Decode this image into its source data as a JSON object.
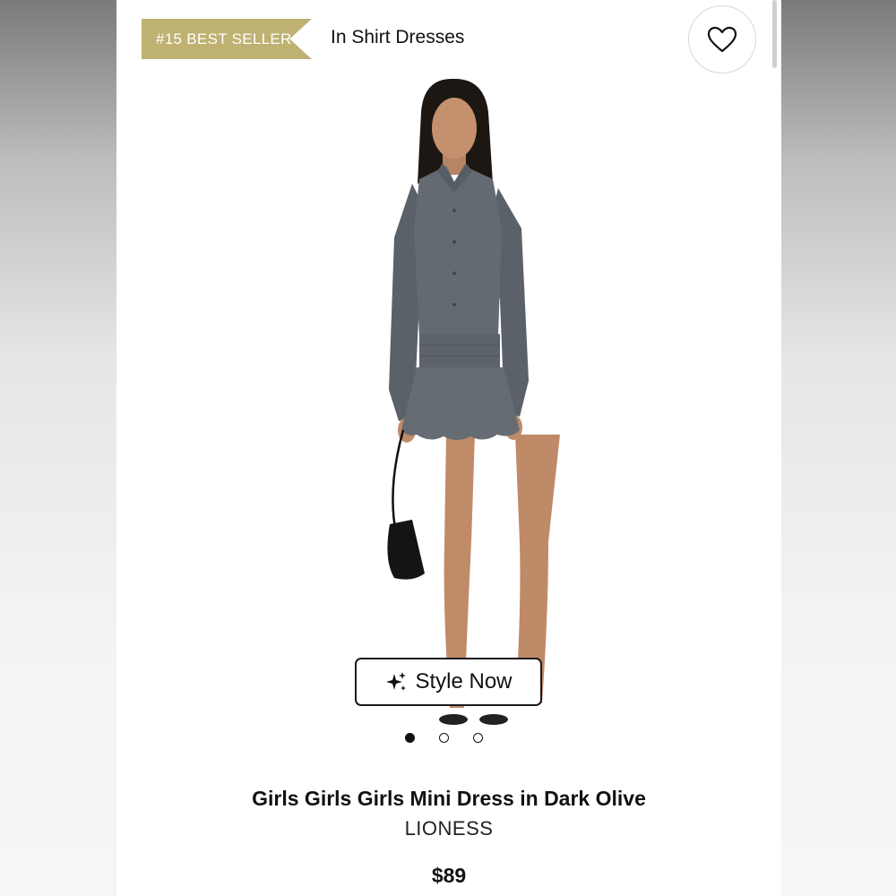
{
  "header": {
    "badge_text": "#15 BEST SELLER",
    "category_text": "In Shirt Dresses",
    "favorite_icon": "heart-outline-icon"
  },
  "colors": {
    "badge_bg": "#bfb172",
    "dress": "#5f656c",
    "text": "#111111"
  },
  "gallery": {
    "style_now_label": "Style Now",
    "style_now_icon": "sparkle-icon",
    "image_count": 3,
    "active_index": 0
  },
  "product": {
    "title": "Girls Girls Girls Mini Dress in Dark Olive",
    "brand": "LIONESS",
    "price": "$89"
  }
}
